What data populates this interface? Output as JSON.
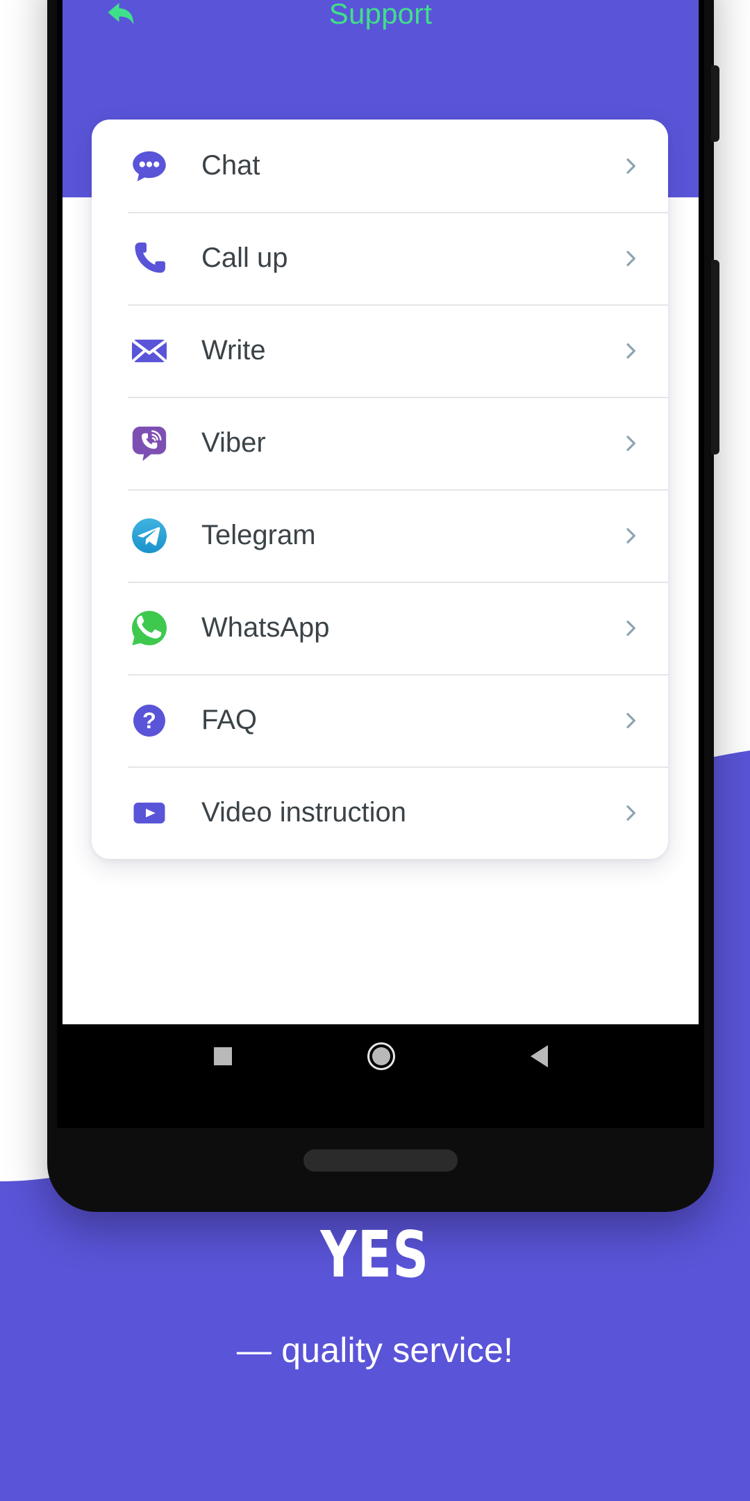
{
  "theme": {
    "purple": "#5a54d8",
    "accent_green": "#3fe08a",
    "text_dark": "#3b4348",
    "chevron": "#8ba4b0",
    "card_bg": "#ffffff",
    "divider": "#e4e6e8"
  },
  "appbar": {
    "title": "Support",
    "back_icon": "back-arrow-icon"
  },
  "menu": {
    "items": [
      {
        "label": "Chat",
        "icon": "chat-bubble-icon",
        "chevron": "chevron-right-icon"
      },
      {
        "label": "Call up",
        "icon": "phone-icon",
        "chevron": "chevron-right-icon"
      },
      {
        "label": "Write",
        "icon": "envelope-icon",
        "chevron": "chevron-right-icon"
      },
      {
        "label": "Viber",
        "icon": "viber-icon",
        "chevron": "chevron-right-icon"
      },
      {
        "label": "Telegram",
        "icon": "telegram-icon",
        "chevron": "chevron-right-icon"
      },
      {
        "label": "WhatsApp",
        "icon": "whatsapp-icon",
        "chevron": "chevron-right-icon"
      },
      {
        "label": "FAQ",
        "icon": "question-mark-icon",
        "chevron": "chevron-right-icon"
      },
      {
        "label": "Video instruction",
        "icon": "play-video-icon",
        "chevron": "chevron-right-icon"
      }
    ]
  },
  "navbar": {
    "recents": "square-recents-icon",
    "home": "circle-home-icon",
    "back": "triangle-back-icon"
  },
  "promo": {
    "headline": "YES",
    "subline": "— quality service!"
  }
}
